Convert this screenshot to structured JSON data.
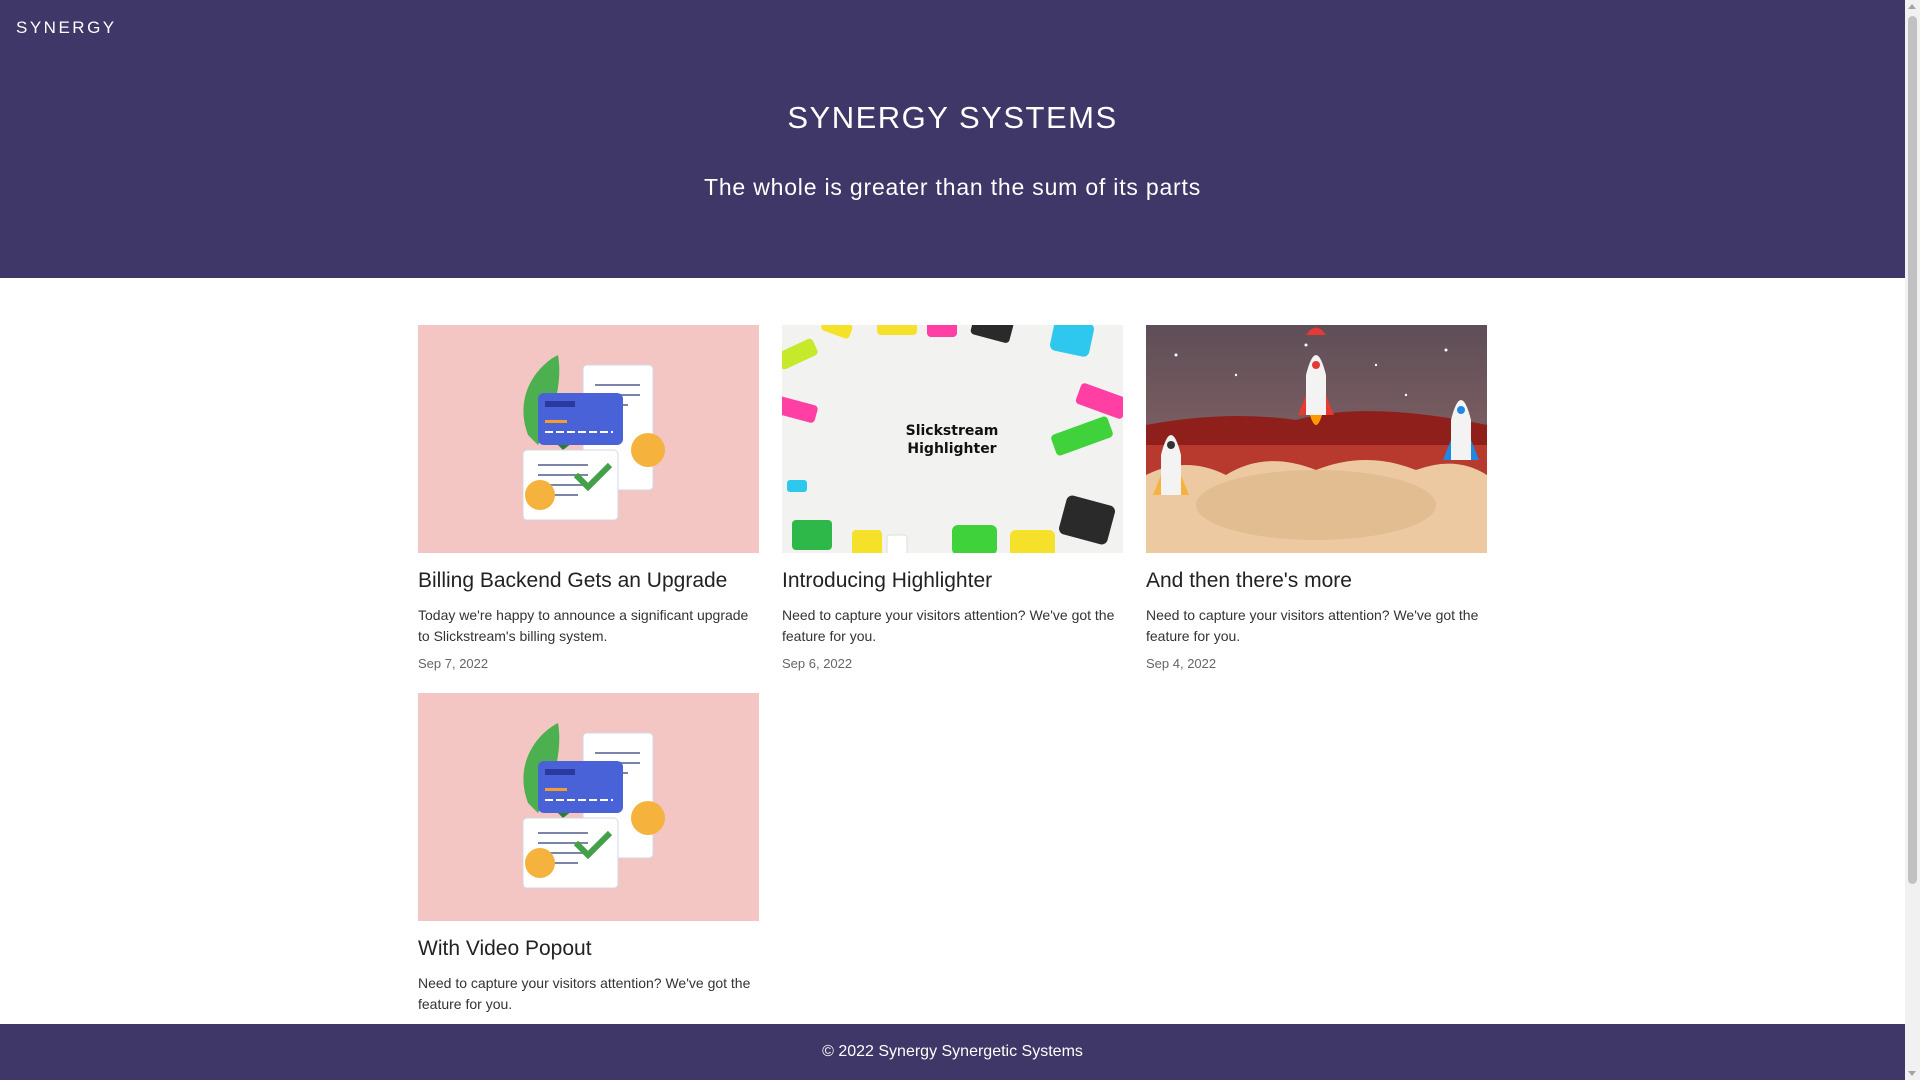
{
  "header": {
    "brand": "SYNERGY",
    "title": "SYNERGY SYSTEMS",
    "tagline": "The whole is greater than the sum of its parts"
  },
  "posts": [
    {
      "title": "Billing Backend Gets an Upgrade",
      "description": "Today we're happy to announce a significant upgrade to Slickstream's billing system.",
      "date": "Sep 7, 2022",
      "image": "billing-illustration"
    },
    {
      "title": "Introducing Highlighter",
      "description": "Need to capture your visitors attention? We've got the feature for you.",
      "date": "Sep 6, 2022",
      "image": "highlighter-markers",
      "image_text": [
        "Slickstream",
        "Highlighter"
      ]
    },
    {
      "title": "And then there's more",
      "description": "Need to capture your visitors attention? We've got the feature for you.",
      "date": "Sep 4, 2022",
      "image": "rockets-launch"
    },
    {
      "title": "With Video Popout",
      "description": "Need to capture your visitors attention? We've got the feature for you.",
      "date": "",
      "image": "billing-illustration"
    }
  ],
  "footer": {
    "text": "© 2022 Synergy Synergetic Systems"
  },
  "colors": {
    "header_bg": "#3e3767",
    "footer_bg": "#3e3767",
    "billing_bg": "#f3c6c3"
  }
}
